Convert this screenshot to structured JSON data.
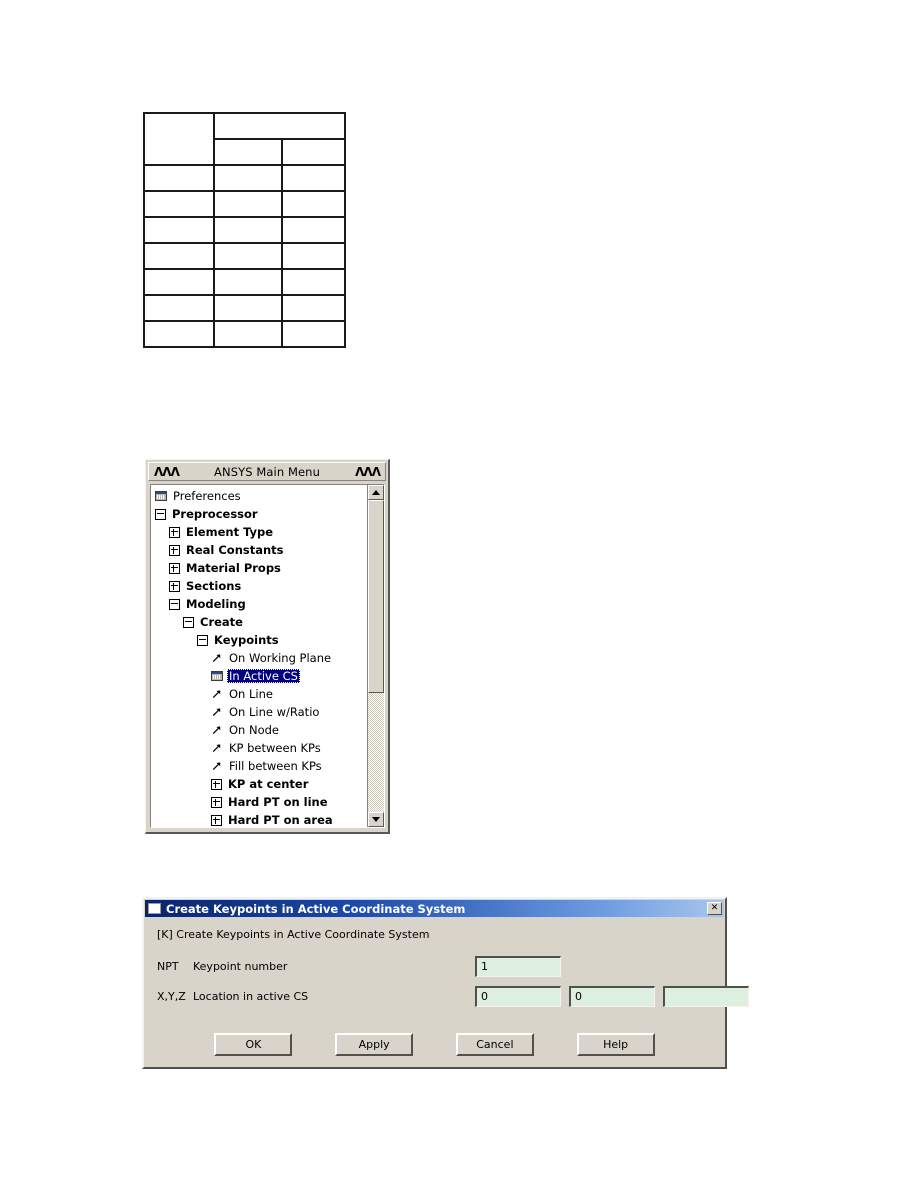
{
  "grid_table": {
    "columns": 3,
    "rows": [
      {
        "cells": [
          {
            "text": "",
            "rowspan": 2
          },
          {
            "text": "",
            "colspan": 2
          }
        ]
      },
      {
        "cells": [
          {
            "text": ""
          },
          {
            "text": ""
          }
        ]
      },
      {
        "cells": [
          {
            "text": ""
          },
          {
            "text": ""
          },
          {
            "text": ""
          }
        ]
      },
      {
        "cells": [
          {
            "text": ""
          },
          {
            "text": ""
          },
          {
            "text": ""
          }
        ]
      },
      {
        "cells": [
          {
            "text": ""
          },
          {
            "text": ""
          },
          {
            "text": ""
          }
        ]
      },
      {
        "cells": [
          {
            "text": ""
          },
          {
            "text": ""
          },
          {
            "text": ""
          }
        ]
      },
      {
        "cells": [
          {
            "text": ""
          },
          {
            "text": ""
          },
          {
            "text": ""
          }
        ]
      },
      {
        "cells": [
          {
            "text": ""
          },
          {
            "text": ""
          },
          {
            "text": ""
          }
        ]
      },
      {
        "cells": [
          {
            "text": ""
          },
          {
            "text": ""
          },
          {
            "text": ""
          }
        ]
      }
    ]
  },
  "ansys_menu": {
    "title": "ANSYS Main Menu",
    "caret_left": "ΛΛΛ",
    "caret_right": "ΛΛΛ",
    "highlight_color": "#000080",
    "tree": [
      {
        "label": "Preferences",
        "indent": 0,
        "icon": "dialog-icon",
        "bold": false,
        "selected": false
      },
      {
        "label": "Preprocessor",
        "indent": 0,
        "icon": "minus-box-icon",
        "bold": true,
        "selected": false
      },
      {
        "label": "Element Type",
        "indent": 1,
        "icon": "plus-box-icon",
        "bold": true,
        "selected": false
      },
      {
        "label": "Real Constants",
        "indent": 1,
        "icon": "plus-box-icon",
        "bold": true,
        "selected": false
      },
      {
        "label": "Material Props",
        "indent": 1,
        "icon": "plus-box-icon",
        "bold": true,
        "selected": false
      },
      {
        "label": "Sections",
        "indent": 1,
        "icon": "plus-box-icon",
        "bold": true,
        "selected": false
      },
      {
        "label": "Modeling",
        "indent": 1,
        "icon": "minus-box-icon",
        "bold": true,
        "selected": false
      },
      {
        "label": "Create",
        "indent": 2,
        "icon": "minus-box-icon",
        "bold": true,
        "selected": false
      },
      {
        "label": "Keypoints",
        "indent": 3,
        "icon": "minus-box-icon",
        "bold": true,
        "selected": false
      },
      {
        "label": "On Working Plane",
        "indent": 4,
        "icon": "arrow-icon",
        "bold": false,
        "selected": false
      },
      {
        "label": "In Active CS",
        "indent": 4,
        "icon": "dialog-icon",
        "bold": false,
        "selected": true
      },
      {
        "label": "On Line",
        "indent": 4,
        "icon": "arrow-icon",
        "bold": false,
        "selected": false
      },
      {
        "label": "On Line w/Ratio",
        "indent": 4,
        "icon": "arrow-icon",
        "bold": false,
        "selected": false
      },
      {
        "label": "On Node",
        "indent": 4,
        "icon": "arrow-icon",
        "bold": false,
        "selected": false
      },
      {
        "label": "KP between KPs",
        "indent": 4,
        "icon": "arrow-icon",
        "bold": false,
        "selected": false
      },
      {
        "label": "Fill between KPs",
        "indent": 4,
        "icon": "arrow-icon",
        "bold": false,
        "selected": false
      },
      {
        "label": "KP at center",
        "indent": 4,
        "icon": "plus-box-icon",
        "bold": true,
        "selected": false
      },
      {
        "label": "Hard PT on line",
        "indent": 4,
        "icon": "plus-box-icon",
        "bold": true,
        "selected": false
      },
      {
        "label": "Hard PT on area",
        "indent": 4,
        "icon": "plus-box-icon",
        "bold": true,
        "selected": false
      }
    ],
    "scrollbar": {
      "up_arrow": "scroll-up-icon",
      "down_arrow": "scroll-down-icon",
      "thumb_fraction": 0.62
    }
  },
  "dialog": {
    "title": "Create Keypoints in Active Coordinate System",
    "close_label": "✕",
    "command_hint": "[K]  Create Keypoints in Active Coordinate System",
    "fields": [
      {
        "code": "NPT",
        "label": "Keypoint number",
        "inputs": [
          {
            "value": "1",
            "placeholder": ""
          }
        ]
      },
      {
        "code": "X,Y,Z",
        "label": "Location in active CS",
        "inputs": [
          {
            "value": "0",
            "placeholder": ""
          },
          {
            "value": "0",
            "placeholder": ""
          },
          {
            "value": "",
            "placeholder": ""
          }
        ]
      }
    ],
    "buttons": [
      {
        "label": "OK"
      },
      {
        "label": "Apply"
      },
      {
        "label": "Cancel"
      },
      {
        "label": "Help"
      }
    ],
    "field_bg_color": "#ddf0e0",
    "titlebar_color": "#0a246a"
  }
}
